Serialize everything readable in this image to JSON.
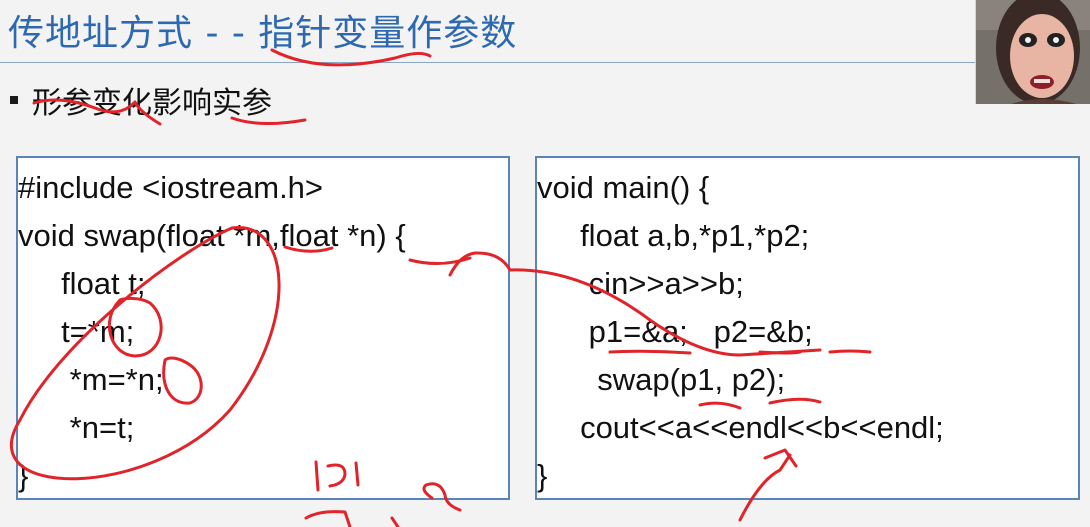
{
  "title": "传地址方式 - - 指针变量作参数",
  "bullet": "形参变化影响实参",
  "left_code": [
    "#include <iostream.h>",
    "void swap(float *m,float *n) {",
    "     float t;",
    "     t=*m;",
    "      *m=*n;",
    "      *n=t;",
    "}"
  ],
  "right_code": [
    "void main() {",
    "     float a,b,*p1,*p2;",
    "      cin>>a>>b;",
    "      p1=&a;   p2=&b;",
    "       swap(p1, p2);",
    "     cout<<a<<endl<<b<<endl;",
    "}"
  ],
  "colors": {
    "title": "#2e69b0",
    "box_border": "#5b84b8",
    "ink": "#e0242a",
    "background": "#f3f3f3"
  }
}
